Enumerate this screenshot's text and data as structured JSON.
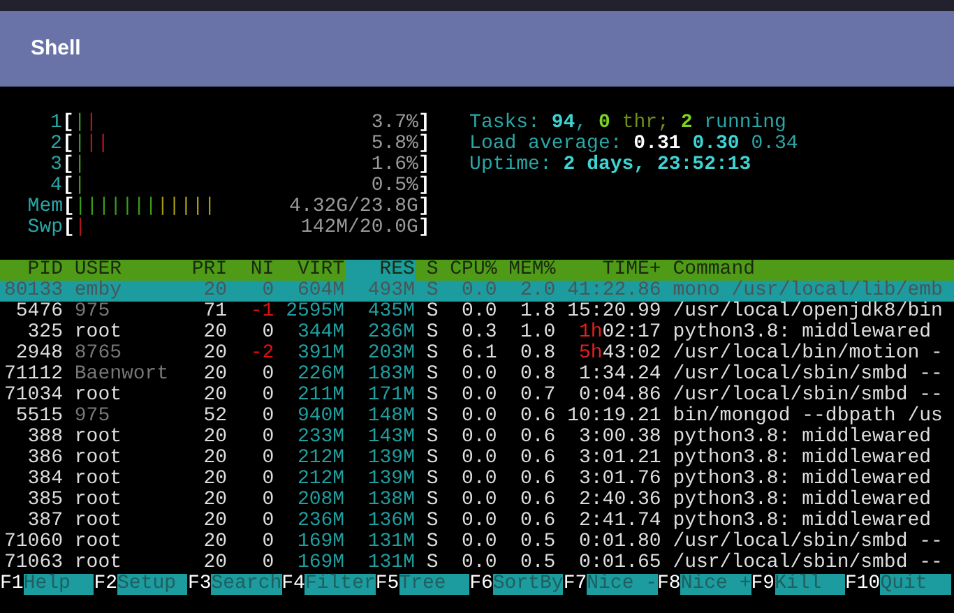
{
  "window": {
    "title": "Shell"
  },
  "meters": [
    {
      "label": "1",
      "left": "[",
      "right": "]",
      "value": "3.7%",
      "segments": [
        {
          "color": "#3a9a1a",
          "text": "|"
        },
        {
          "color": "#b01818",
          "text": "|"
        }
      ]
    },
    {
      "label": "2",
      "left": "[",
      "right": "]",
      "value": "5.8%",
      "segments": [
        {
          "color": "#3a9a1a",
          "text": "|"
        },
        {
          "color": "#b01818",
          "text": "||"
        }
      ]
    },
    {
      "label": "3",
      "left": "[",
      "right": "]",
      "value": "1.6%",
      "segments": [
        {
          "color": "#3a9a1a",
          "text": "|"
        }
      ]
    },
    {
      "label": "4",
      "left": "[",
      "right": "]",
      "value": "0.5%",
      "segments": [
        {
          "color": "#3a9a1a",
          "text": "|"
        }
      ]
    },
    {
      "label": "Mem",
      "left": "[",
      "right": "]",
      "value": "4.32G/23.8G",
      "segments": [
        {
          "color": "#3a9a1a",
          "text": "|||||||"
        },
        {
          "color": "#a89a10",
          "text": "|||||"
        }
      ]
    },
    {
      "label": "Swp",
      "left": "[",
      "right": "]",
      "value": "142M/20.0G",
      "segments": [
        {
          "color": "#b01818",
          "text": "|"
        }
      ]
    }
  ],
  "stats": [
    [
      {
        "kind": "label",
        "text": "Tasks:"
      },
      {
        "kind": "value",
        "text": "94"
      },
      {
        "kind": "label",
        "text": ","
      },
      {
        "kind": "thread",
        "text": "0"
      },
      {
        "kind": "dim",
        "text": "thr;"
      },
      {
        "kind": "thread",
        "text": "2"
      },
      {
        "kind": "label",
        "text": "running"
      }
    ],
    [
      {
        "kind": "label",
        "text": "Load average:"
      },
      {
        "kind": "bright",
        "text": "0.31"
      },
      {
        "kind": "value",
        "text": "0.30"
      },
      {
        "kind": "label",
        "text": "0.34"
      }
    ],
    [
      {
        "kind": "label",
        "text": "Uptime:"
      },
      {
        "kind": "value",
        "text": "2 days, 23:52:13"
      }
    ]
  ],
  "columns": [
    {
      "label": "PID",
      "sorted": false
    },
    {
      "label": "USER",
      "sorted": false
    },
    {
      "label": "PRI",
      "sorted": false
    },
    {
      "label": "NI",
      "sorted": false
    },
    {
      "label": "VIRT",
      "sorted": false
    },
    {
      "label": "RES",
      "sorted": true
    },
    {
      "label": "S",
      "sorted": false
    },
    {
      "label": "CPU%",
      "sorted": false
    },
    {
      "label": "MEM%",
      "sorted": false
    },
    {
      "label": "TIME+",
      "sorted": false
    },
    {
      "label": "Command",
      "sorted": false
    }
  ],
  "rows": [
    {
      "selected": true,
      "pid": "80133",
      "user": "emby",
      "user_dimmed": false,
      "pri": "20",
      "ni": "0",
      "nice_alert": false,
      "virt": "604M",
      "res": "493M",
      "state": "S",
      "cpu": "0.0",
      "mem": "2.0",
      "time": "41:22.86",
      "command": "mono /usr/local/lib/emb"
    },
    {
      "selected": false,
      "pid": "5476",
      "user": "975",
      "user_dimmed": true,
      "pri": "71",
      "ni": "-1",
      "nice_alert": true,
      "virt": "2595M",
      "res": "435M",
      "state": "S",
      "cpu": "0.0",
      "mem": "1.8",
      "time": "15:20.99",
      "command": "/usr/local/openjdk8/bin"
    },
    {
      "selected": false,
      "pid": "325",
      "user": "root",
      "user_dimmed": false,
      "pri": "20",
      "ni": "0",
      "nice_alert": false,
      "virt": "344M",
      "res": "236M",
      "state": "S",
      "cpu": "0.3",
      "mem": "1.0",
      "time_hours": "1h",
      "time": "02:17",
      "command": "python3.8: middlewared"
    },
    {
      "selected": false,
      "pid": "2948",
      "user": "8765",
      "user_dimmed": true,
      "pri": "20",
      "ni": "-2",
      "nice_alert": true,
      "virt": "391M",
      "res": "203M",
      "state": "S",
      "cpu": "6.1",
      "mem": "0.8",
      "time_hours": "5h",
      "time": "43:02",
      "command": "/usr/local/bin/motion -"
    },
    {
      "selected": false,
      "pid": "71112",
      "user": "Baenwort",
      "user_dimmed": true,
      "pri": "20",
      "ni": "0",
      "nice_alert": false,
      "virt": "226M",
      "res": "183M",
      "state": "S",
      "cpu": "0.0",
      "mem": "0.8",
      "time": "1:34.24",
      "command": "/usr/local/sbin/smbd --"
    },
    {
      "selected": false,
      "pid": "71034",
      "user": "root",
      "user_dimmed": false,
      "pri": "20",
      "ni": "0",
      "nice_alert": false,
      "virt": "211M",
      "res": "171M",
      "state": "S",
      "cpu": "0.0",
      "mem": "0.7",
      "time": "0:04.86",
      "command": "/usr/local/sbin/smbd --"
    },
    {
      "selected": false,
      "pid": "5515",
      "user": "975",
      "user_dimmed": true,
      "pri": "52",
      "ni": "0",
      "nice_alert": false,
      "virt": "940M",
      "res": "148M",
      "state": "S",
      "cpu": "0.0",
      "mem": "0.6",
      "time": "10:19.21",
      "command": "bin/mongod --dbpath /us"
    },
    {
      "selected": false,
      "pid": "388",
      "user": "root",
      "user_dimmed": false,
      "pri": "20",
      "ni": "0",
      "nice_alert": false,
      "virt": "233M",
      "res": "143M",
      "state": "S",
      "cpu": "0.0",
      "mem": "0.6",
      "time": "3:00.38",
      "command": "python3.8: middlewared"
    },
    {
      "selected": false,
      "pid": "386",
      "user": "root",
      "user_dimmed": false,
      "pri": "20",
      "ni": "0",
      "nice_alert": false,
      "virt": "212M",
      "res": "139M",
      "state": "S",
      "cpu": "0.0",
      "mem": "0.6",
      "time": "3:01.21",
      "command": "python3.8: middlewared"
    },
    {
      "selected": false,
      "pid": "384",
      "user": "root",
      "user_dimmed": false,
      "pri": "20",
      "ni": "0",
      "nice_alert": false,
      "virt": "212M",
      "res": "139M",
      "state": "S",
      "cpu": "0.0",
      "mem": "0.6",
      "time": "3:01.76",
      "command": "python3.8: middlewared"
    },
    {
      "selected": false,
      "pid": "385",
      "user": "root",
      "user_dimmed": false,
      "pri": "20",
      "ni": "0",
      "nice_alert": false,
      "virt": "208M",
      "res": "138M",
      "state": "S",
      "cpu": "0.0",
      "mem": "0.6",
      "time": "2:40.36",
      "command": "python3.8: middlewared"
    },
    {
      "selected": false,
      "pid": "387",
      "user": "root",
      "user_dimmed": false,
      "pri": "20",
      "ni": "0",
      "nice_alert": false,
      "virt": "236M",
      "res": "136M",
      "state": "S",
      "cpu": "0.0",
      "mem": "0.6",
      "time": "2:41.74",
      "command": "python3.8: middlewared"
    },
    {
      "selected": false,
      "pid": "71060",
      "user": "root",
      "user_dimmed": false,
      "pri": "20",
      "ni": "0",
      "nice_alert": false,
      "virt": "169M",
      "res": "131M",
      "state": "S",
      "cpu": "0.0",
      "mem": "0.5",
      "time": "0:01.80",
      "command": "/usr/local/sbin/smbd --"
    },
    {
      "selected": false,
      "pid": "71063",
      "user": "root",
      "user_dimmed": false,
      "pri": "20",
      "ni": "0",
      "nice_alert": false,
      "virt": "169M",
      "res": "131M",
      "state": "S",
      "cpu": "0.0",
      "mem": "0.5",
      "time": "0:01.65",
      "command": "/usr/local/sbin/smbd --"
    }
  ],
  "function_keys": [
    {
      "key": "F1",
      "label": "Help"
    },
    {
      "key": "F2",
      "label": "Setup"
    },
    {
      "key": "F3",
      "label": "Search"
    },
    {
      "key": "F4",
      "label": "Filter"
    },
    {
      "key": "F5",
      "label": "Tree"
    },
    {
      "key": "F6",
      "label": "SortBy"
    },
    {
      "key": "F7",
      "label": "Nice -"
    },
    {
      "key": "F8",
      "label": "Nice +"
    },
    {
      "key": "F9",
      "label": "Kill"
    },
    {
      "key": "F10",
      "label": "Quit"
    }
  ]
}
